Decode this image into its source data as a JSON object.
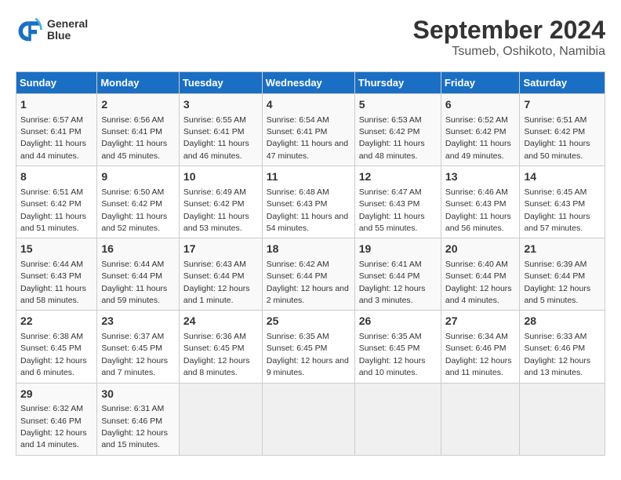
{
  "header": {
    "logo_line1": "General",
    "logo_line2": "Blue",
    "title": "September 2024",
    "subtitle": "Tsumeb, Oshikoto, Namibia"
  },
  "days_of_week": [
    "Sunday",
    "Monday",
    "Tuesday",
    "Wednesday",
    "Thursday",
    "Friday",
    "Saturday"
  ],
  "weeks": [
    [
      {
        "day": 1,
        "sunrise": "6:57 AM",
        "sunset": "6:41 PM",
        "daylight": "11 hours and 44 minutes."
      },
      {
        "day": 2,
        "sunrise": "6:56 AM",
        "sunset": "6:41 PM",
        "daylight": "11 hours and 45 minutes."
      },
      {
        "day": 3,
        "sunrise": "6:55 AM",
        "sunset": "6:41 PM",
        "daylight": "11 hours and 46 minutes."
      },
      {
        "day": 4,
        "sunrise": "6:54 AM",
        "sunset": "6:41 PM",
        "daylight": "11 hours and 47 minutes."
      },
      {
        "day": 5,
        "sunrise": "6:53 AM",
        "sunset": "6:42 PM",
        "daylight": "11 hours and 48 minutes."
      },
      {
        "day": 6,
        "sunrise": "6:52 AM",
        "sunset": "6:42 PM",
        "daylight": "11 hours and 49 minutes."
      },
      {
        "day": 7,
        "sunrise": "6:51 AM",
        "sunset": "6:42 PM",
        "daylight": "11 hours and 50 minutes."
      }
    ],
    [
      {
        "day": 8,
        "sunrise": "6:51 AM",
        "sunset": "6:42 PM",
        "daylight": "11 hours and 51 minutes."
      },
      {
        "day": 9,
        "sunrise": "6:50 AM",
        "sunset": "6:42 PM",
        "daylight": "11 hours and 52 minutes."
      },
      {
        "day": 10,
        "sunrise": "6:49 AM",
        "sunset": "6:42 PM",
        "daylight": "11 hours and 53 minutes."
      },
      {
        "day": 11,
        "sunrise": "6:48 AM",
        "sunset": "6:43 PM",
        "daylight": "11 hours and 54 minutes."
      },
      {
        "day": 12,
        "sunrise": "6:47 AM",
        "sunset": "6:43 PM",
        "daylight": "11 hours and 55 minutes."
      },
      {
        "day": 13,
        "sunrise": "6:46 AM",
        "sunset": "6:43 PM",
        "daylight": "11 hours and 56 minutes."
      },
      {
        "day": 14,
        "sunrise": "6:45 AM",
        "sunset": "6:43 PM",
        "daylight": "11 hours and 57 minutes."
      }
    ],
    [
      {
        "day": 15,
        "sunrise": "6:44 AM",
        "sunset": "6:43 PM",
        "daylight": "11 hours and 58 minutes."
      },
      {
        "day": 16,
        "sunrise": "6:44 AM",
        "sunset": "6:44 PM",
        "daylight": "11 hours and 59 minutes."
      },
      {
        "day": 17,
        "sunrise": "6:43 AM",
        "sunset": "6:44 PM",
        "daylight": "12 hours and 1 minute."
      },
      {
        "day": 18,
        "sunrise": "6:42 AM",
        "sunset": "6:44 PM",
        "daylight": "12 hours and 2 minutes."
      },
      {
        "day": 19,
        "sunrise": "6:41 AM",
        "sunset": "6:44 PM",
        "daylight": "12 hours and 3 minutes."
      },
      {
        "day": 20,
        "sunrise": "6:40 AM",
        "sunset": "6:44 PM",
        "daylight": "12 hours and 4 minutes."
      },
      {
        "day": 21,
        "sunrise": "6:39 AM",
        "sunset": "6:44 PM",
        "daylight": "12 hours and 5 minutes."
      }
    ],
    [
      {
        "day": 22,
        "sunrise": "6:38 AM",
        "sunset": "6:45 PM",
        "daylight": "12 hours and 6 minutes."
      },
      {
        "day": 23,
        "sunrise": "6:37 AM",
        "sunset": "6:45 PM",
        "daylight": "12 hours and 7 minutes."
      },
      {
        "day": 24,
        "sunrise": "6:36 AM",
        "sunset": "6:45 PM",
        "daylight": "12 hours and 8 minutes."
      },
      {
        "day": 25,
        "sunrise": "6:35 AM",
        "sunset": "6:45 PM",
        "daylight": "12 hours and 9 minutes."
      },
      {
        "day": 26,
        "sunrise": "6:35 AM",
        "sunset": "6:45 PM",
        "daylight": "12 hours and 10 minutes."
      },
      {
        "day": 27,
        "sunrise": "6:34 AM",
        "sunset": "6:46 PM",
        "daylight": "12 hours and 11 minutes."
      },
      {
        "day": 28,
        "sunrise": "6:33 AM",
        "sunset": "6:46 PM",
        "daylight": "12 hours and 13 minutes."
      }
    ],
    [
      {
        "day": 29,
        "sunrise": "6:32 AM",
        "sunset": "6:46 PM",
        "daylight": "12 hours and 14 minutes."
      },
      {
        "day": 30,
        "sunrise": "6:31 AM",
        "sunset": "6:46 PM",
        "daylight": "12 hours and 15 minutes."
      },
      null,
      null,
      null,
      null,
      null
    ]
  ]
}
